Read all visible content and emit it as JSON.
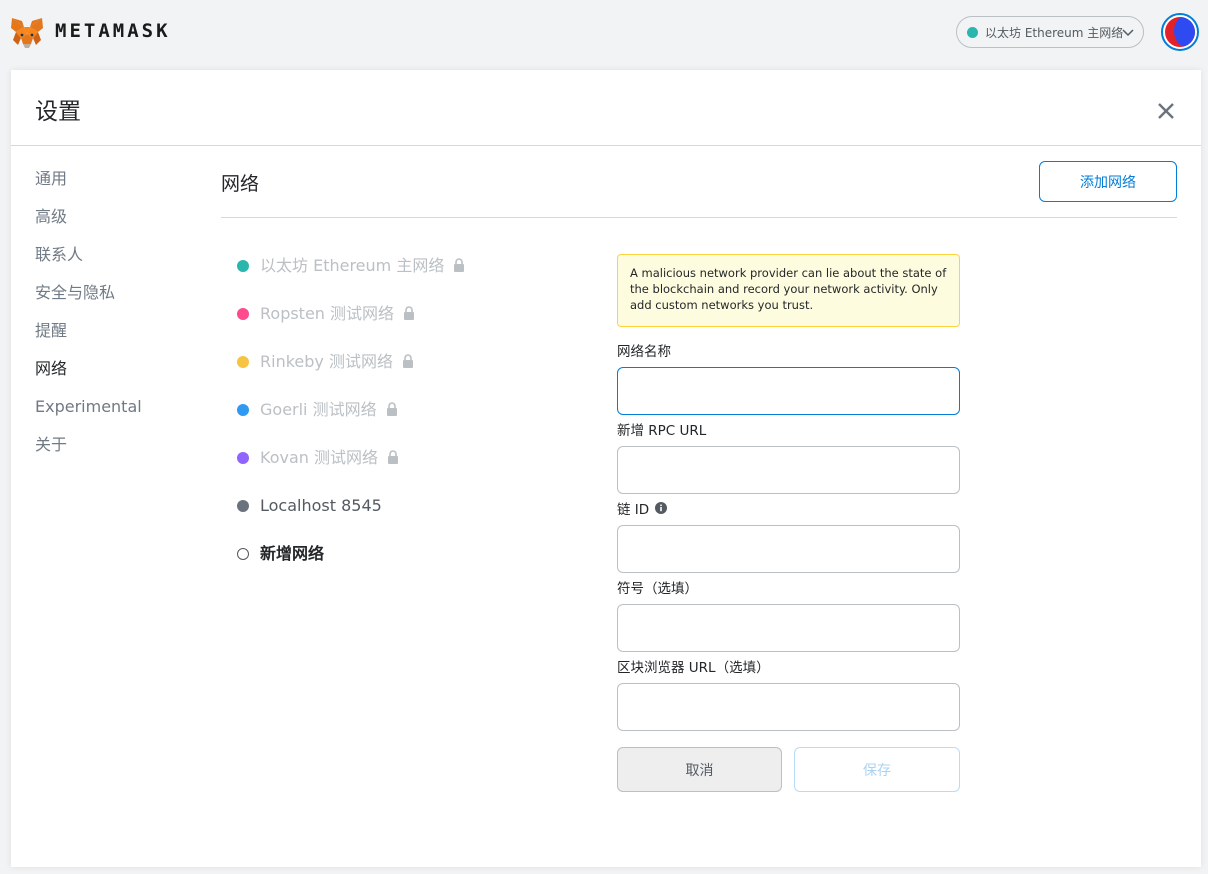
{
  "header": {
    "brand": "METAMASK",
    "network_selector": {
      "label": "以太坊 Ethereum 主网络",
      "dot_color": "#29b6af"
    }
  },
  "panel": {
    "title": "设置"
  },
  "sidebar": {
    "items": [
      {
        "label": "通用",
        "active": false
      },
      {
        "label": "高级",
        "active": false
      },
      {
        "label": "联系人",
        "active": false
      },
      {
        "label": "安全与隐私",
        "active": false
      },
      {
        "label": "提醒",
        "active": false
      },
      {
        "label": "网络",
        "active": true
      },
      {
        "label": "Experimental",
        "active": false
      },
      {
        "label": "关于",
        "active": false
      }
    ]
  },
  "content": {
    "section_title": "网络",
    "add_network_button": "添加网络",
    "networks": [
      {
        "label": "以太坊 Ethereum 主网络",
        "color": "#29b6af",
        "locked": true
      },
      {
        "label": "Ropsten 测试网络",
        "color": "#ff4a8d",
        "locked": true
      },
      {
        "label": "Rinkeby 测试网络",
        "color": "#f6c343",
        "locked": true
      },
      {
        "label": "Goerli 测试网络",
        "color": "#3099f2",
        "locked": true
      },
      {
        "label": "Kovan 测试网络",
        "color": "#9064ff",
        "locked": true
      },
      {
        "label": "Localhost 8545",
        "color": "#6a737d",
        "locked": false
      },
      {
        "label": "新增网络",
        "color": "#ffffff",
        "locked": false
      }
    ]
  },
  "form": {
    "warning": "A malicious network provider can lie about the state of the blockchain and record your network activity. Only add custom networks you trust.",
    "network_name_label": "网络名称",
    "rpc_url_label": "新增 RPC URL",
    "chain_id_label": "链 ID",
    "symbol_label": "符号（选填）",
    "explorer_label": "区块浏览器 URL（选填）",
    "cancel_button": "取消",
    "save_button": "保存"
  }
}
